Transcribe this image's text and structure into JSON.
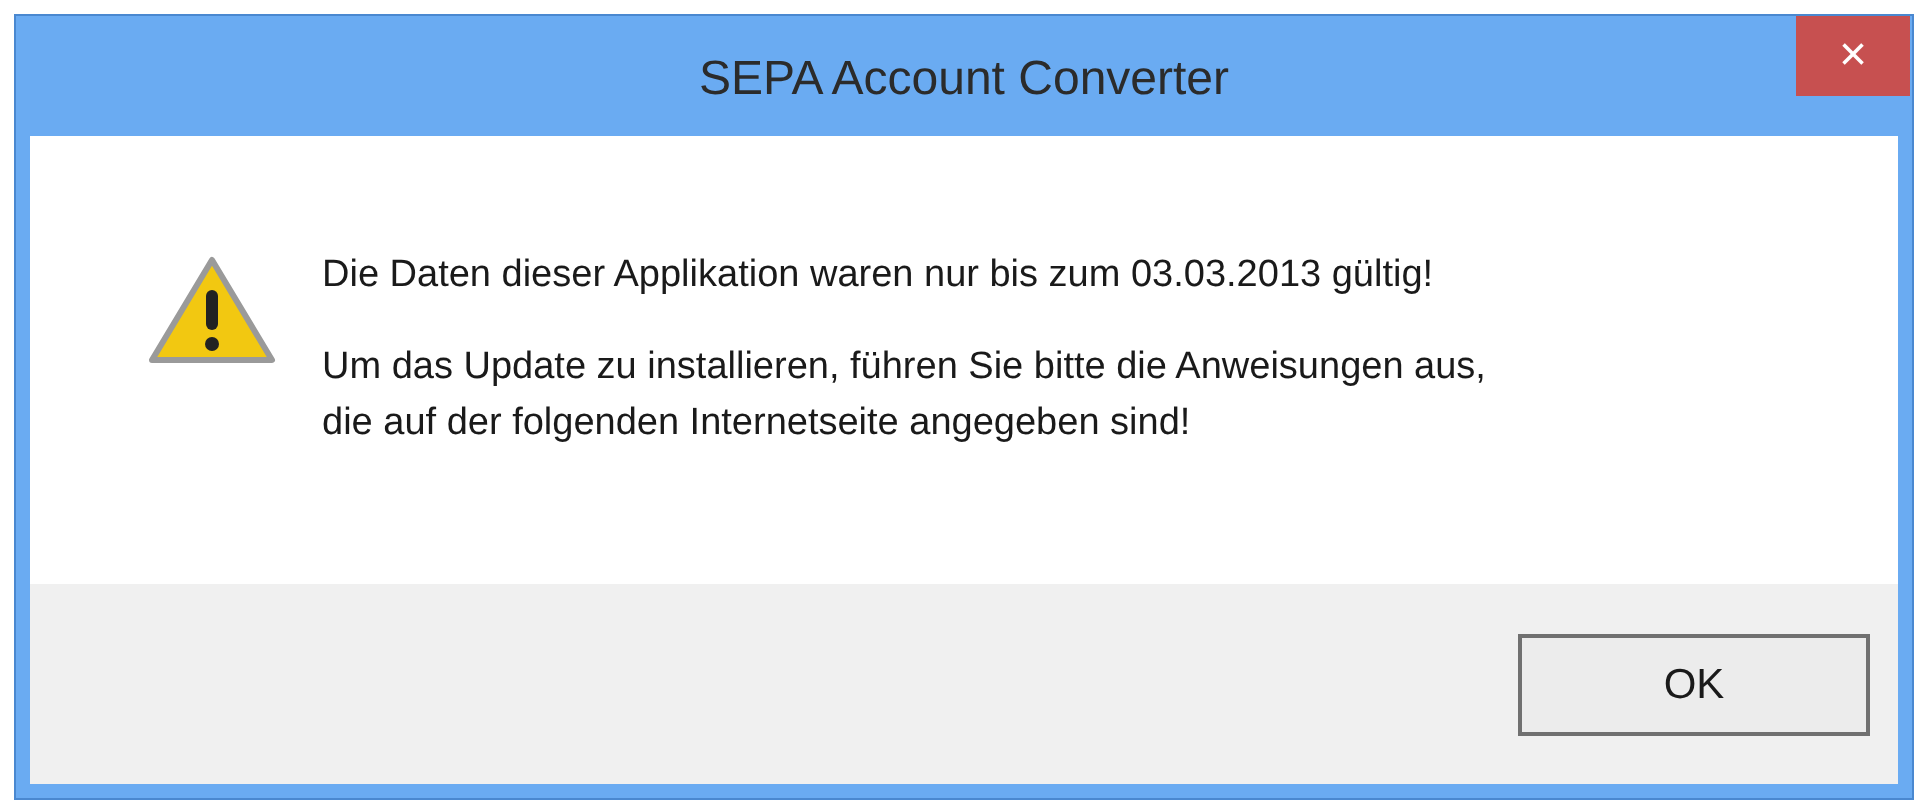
{
  "window": {
    "title": "SEPA Account Converter",
    "close": "×"
  },
  "message": {
    "lines": [
      "Die Daten dieser Applikation waren nur bis zum 03.03.2013 gültig!",
      "Um das Update zu installieren, führen Sie bitte die Anweisungen aus,\ndie auf der folgenden Internetseite angegeben sind!"
    ]
  },
  "buttons": [
    "OK"
  ]
}
